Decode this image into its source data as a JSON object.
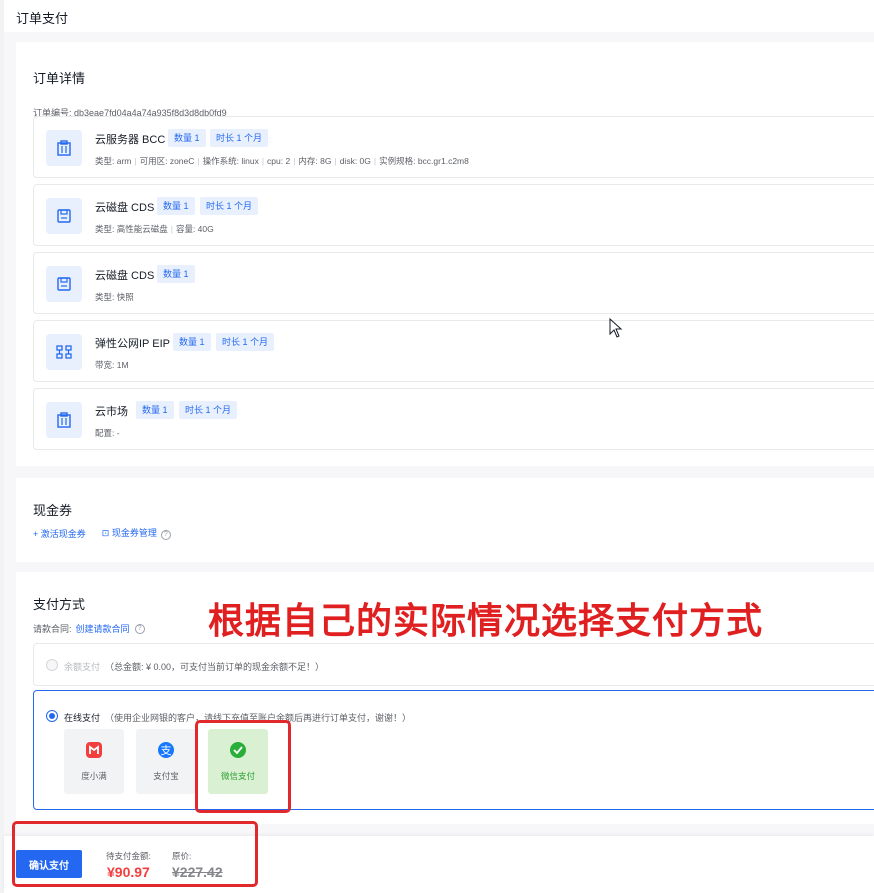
{
  "header": {
    "title": "订单支付"
  },
  "order": {
    "section_title": "订单详情",
    "order_no_label": "订单编号:",
    "order_no": "db3eae7fd04a4a74a935f8d3d8db0fd9",
    "items": [
      {
        "name": "云服务器 BCC",
        "tags": [
          "数量 1",
          "时长 1 个月"
        ],
        "details": [
          "类型: arm",
          "可用区: zoneC",
          "操作系统: linux",
          "cpu: 2",
          "内存: 8G",
          "disk: 0G",
          "实例规格: bcc.gr1.c2m8"
        ],
        "icon": "building-icon"
      },
      {
        "name": "云磁盘 CDS",
        "tags": [
          "数量 1",
          "时长 1 个月"
        ],
        "details": [
          "类型: 高性能云磁盘",
          "容量: 40G"
        ],
        "icon": "disk-icon"
      },
      {
        "name": "云磁盘 CDS",
        "tags": [
          "数量 1"
        ],
        "details": [
          "类型: 快照"
        ],
        "icon": "disk-icon"
      },
      {
        "name": "弹性公网IP EIP",
        "tags": [
          "数量 1",
          "时长 1 个月"
        ],
        "details": [
          "带宽: 1M"
        ],
        "icon": "network-icon"
      },
      {
        "name": "云市场",
        "tags": [
          "数量 1",
          "时长 1 个月"
        ],
        "details": [
          "配置: -"
        ],
        "icon": "building-icon"
      }
    ]
  },
  "coupon": {
    "section_title": "现金券",
    "activate_label": "激活现金券",
    "manage_label": "现金券管理"
  },
  "payment": {
    "section_title": "支付方式",
    "contract_label": "请款合同:",
    "contract_link": "创建请款合同",
    "balance_option": "余额支付",
    "balance_note": "（总金额: ¥ 0.00，可支付当前订单的现金余额不足！）",
    "online_option": "在线支付",
    "online_note": "（使用企业网银的客户，请线下充值至账户余额后再进行订单支付，谢谢！）",
    "methods": [
      {
        "label": "度小满",
        "icon": "duxiaoman-icon",
        "color": "#f33e3e"
      },
      {
        "label": "支付宝",
        "icon": "alipay-icon",
        "color": "#1677ff"
      },
      {
        "label": "微信支付",
        "icon": "wechat-icon",
        "color": "#2aae3a"
      }
    ]
  },
  "annotation": "根据自己的实际情况选择支付方式",
  "footer": {
    "confirm_label": "确认支付",
    "due_label": "待支付金额:",
    "due_amount": "¥90.97",
    "original_label": "原价:",
    "original_amount": "¥227.42"
  },
  "colors": {
    "accent": "#2468f2",
    "annotation": "#e02020",
    "price": "#f33e3e"
  }
}
